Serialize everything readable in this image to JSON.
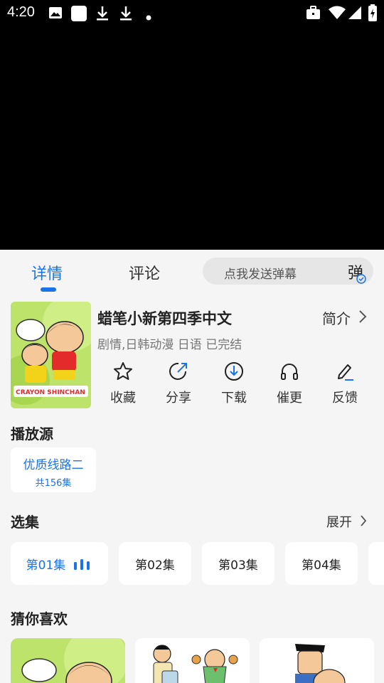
{
  "status_bar": {
    "time": "4:20",
    "left_icons": [
      "image-icon",
      "app-icon",
      "download-icon",
      "download-icon",
      "dot-icon"
    ],
    "right_icons": [
      "briefcase-icon",
      "wifi-icon",
      "signal-icon",
      "battery-icon"
    ]
  },
  "tabs": [
    {
      "label": "详情",
      "active": true
    },
    {
      "label": "评论",
      "active": false
    }
  ],
  "danmu": {
    "placeholder": "点我发送弹幕",
    "button_label": "弹"
  },
  "show": {
    "title": "蜡笔小新第四季中文",
    "meta": "剧情,日韩动漫 日语 已完结",
    "intro_label": "简介"
  },
  "actions": [
    {
      "label": "收藏",
      "icon": "star-icon"
    },
    {
      "label": "分享",
      "icon": "share-icon"
    },
    {
      "label": "下载",
      "icon": "download-icon"
    },
    {
      "label": "催更",
      "icon": "headphones-icon"
    },
    {
      "label": "反馈",
      "icon": "edit-icon"
    }
  ],
  "source": {
    "section_title": "播放源",
    "name": "优质线路二",
    "count": "共156集"
  },
  "episodes": {
    "section_title": "选集",
    "expand_label": "展开",
    "items": [
      {
        "label": "第01集",
        "active": true
      },
      {
        "label": "第02集",
        "active": false
      },
      {
        "label": "第03集",
        "active": false
      },
      {
        "label": "第04集",
        "active": false
      }
    ]
  },
  "recommend": {
    "section_title": "猜你喜欢"
  },
  "colors": {
    "accent": "#1a73e8",
    "panel_bg": "#f5f5f5",
    "card_bg": "#ffffff"
  }
}
